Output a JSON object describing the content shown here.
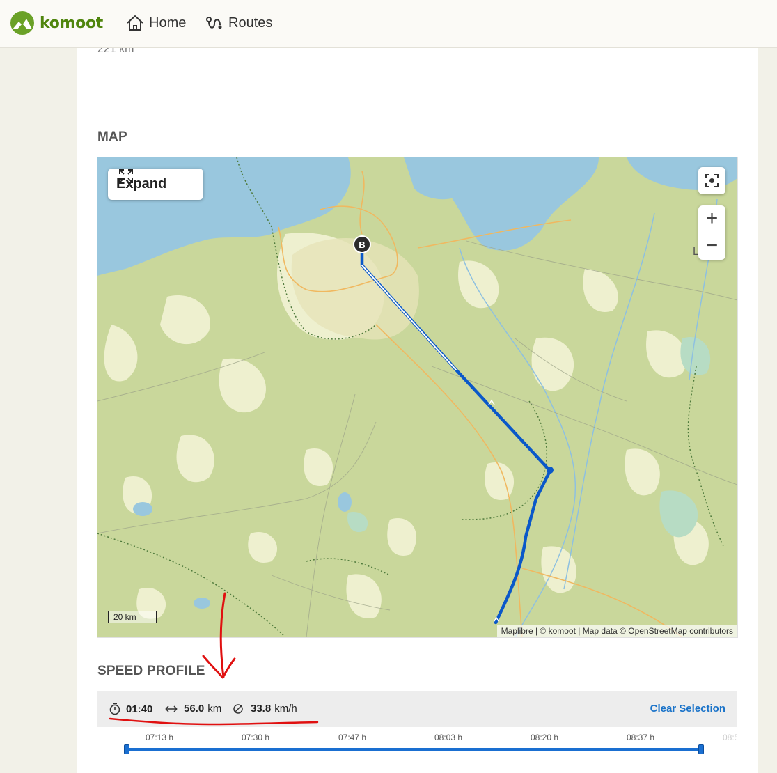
{
  "header": {
    "brand": "komoot",
    "nav": [
      {
        "label": "Home",
        "icon": "home-icon"
      },
      {
        "label": "Routes",
        "icon": "route-icon"
      }
    ]
  },
  "tour": {
    "distance_text": "221 km"
  },
  "map_section": {
    "title": "MAP",
    "expand_label": "Expand",
    "scale_label": "20 km",
    "attribution": "Maplibre | © komoot | Map data © OpenStreetMap contributors",
    "edge_label": "L   N",
    "marker_label": "B",
    "zoom_in": "+",
    "zoom_out": "−",
    "colors": {
      "route": "#0a58c9",
      "land": "#c9d79b",
      "forest_clearing": "#eef0cf",
      "water": "#99c7de",
      "road": "#f0b860"
    }
  },
  "speed_profile": {
    "title": "SPEED PROFILE",
    "duration": "01:40",
    "distance_value": "56.0",
    "distance_unit": "km",
    "speed_value": "33.8",
    "speed_unit": "km/h",
    "clear_label": "Clear Selection",
    "ticks": [
      "07:13 h",
      "07:30 h",
      "07:47 h",
      "08:03 h",
      "08:20 h",
      "08:37 h",
      "08:5"
    ]
  }
}
